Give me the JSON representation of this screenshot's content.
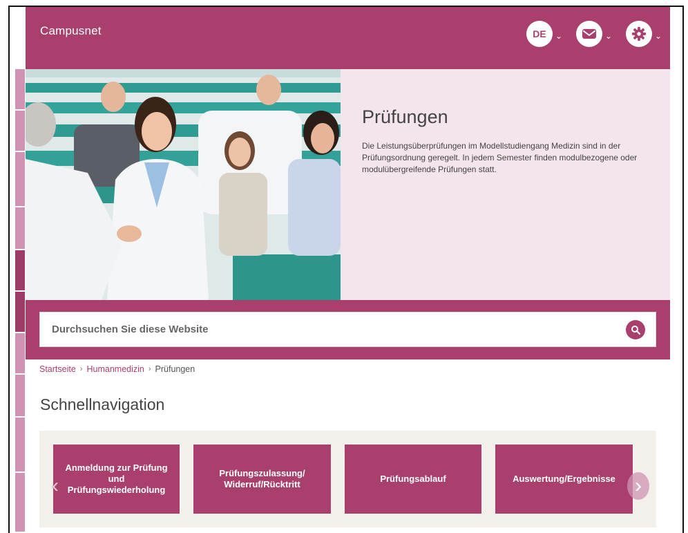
{
  "header": {
    "brand": "Campusnet",
    "language_label": "DE",
    "chevron": "⌄"
  },
  "hero": {
    "title": "Prüfungen",
    "text": "Die Leistungsüberprüfungen im Modellstudiengang Medizin sind in der Prüfungsordnung geregelt. In jedem Semester finden modulbezogene oder modulübergreifende Prüfungen statt."
  },
  "search": {
    "placeholder": "Durchsuchen Sie diese Website"
  },
  "breadcrumb": {
    "items": [
      "Startseite",
      "Humanmedizin",
      "Prüfungen"
    ],
    "separator": "›"
  },
  "quicknav": {
    "heading": "Schnellnavigation",
    "tiles": [
      "Anmeldung zur Prüfung und Prüfungswiederholung",
      "Prüfungszulassung/ Widerruf/Rücktritt",
      "Prüfungsablauf",
      "Auswertung/Ergebnisse"
    ],
    "prev_arrow": "‹",
    "next_arrow": "›"
  },
  "colors": {
    "brand": "#a83f6d",
    "hero_bg": "#f4e4ec",
    "quicknav_bg": "#f3efeb",
    "rail": "#cf94b3"
  },
  "icons": {
    "mail": "mail-icon",
    "settings": "gear-icon",
    "search": "search-icon"
  }
}
